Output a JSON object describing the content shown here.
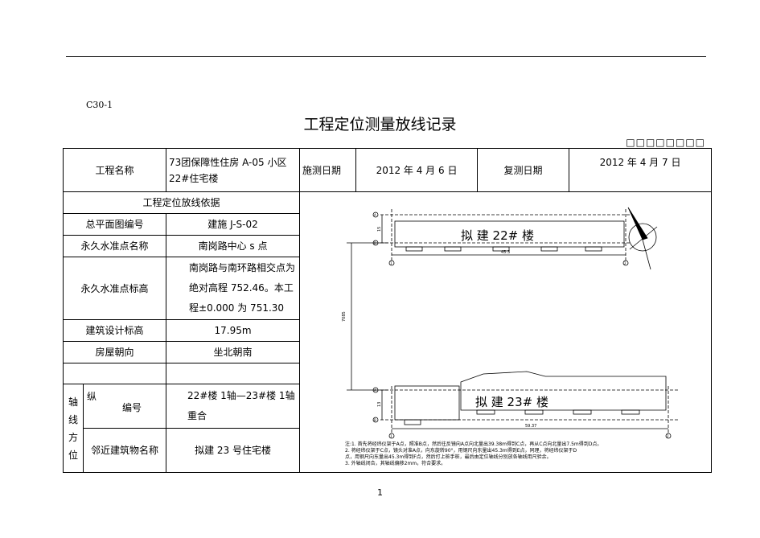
{
  "header": {
    "form_code": "C30-1",
    "title": "工程定位测量放线记录",
    "boxes": "□□□□□□□□"
  },
  "table": {
    "project_name_label": "工程名称",
    "project_name_value": "73团保障性住房 A-05 小区 22#住宅楼",
    "survey_date_label": "施测日期",
    "survey_date_value": "2012 年 4 月 6 日",
    "recheck_date_label": "复测日期",
    "recheck_date_value": "2012 年 4 月 7 日",
    "basis_header": "工程定位放线依据",
    "rows": [
      {
        "label": "总平面图编号",
        "value": "建施 J-S-02"
      },
      {
        "label": "永久水准点名称",
        "value": "南岗路中心 s 点"
      },
      {
        "label": "永久水准点标高",
        "value": "南岗路与南环路相交点为绝对高程 752.46。本工程±0.000 为 751.30"
      },
      {
        "label": "建筑设计标高",
        "value": "17.95m"
      },
      {
        "label": "房屋朝向",
        "value": "坐北朝南"
      },
      {
        "label": "",
        "value": ""
      }
    ],
    "axis_label": "轴线方位",
    "axis_sub1": "纵",
    "axis_no_label": "编号",
    "axis_no_value": "22#楼 1轴—23#楼 1轴重合",
    "adjacent_label": "邻近建筑物名称",
    "adjacent_value": "拟建 23 号住宅楼"
  },
  "drawing": {
    "building1": "拟 建 22# 楼",
    "building2": "拟 建 23# 楼",
    "dim_top": "45.3",
    "dim_bottom": "59.37",
    "dim_vertical": "7085",
    "dim_small1": "15",
    "dim_small2": "13",
    "axis_a": "A",
    "axis_b": "B",
    "axis_1": "1",
    "axis_2": "2",
    "notes": [
      "注:1. 首先将经纬仪架于A点，照准B点，然后往反镜向A点向北量出39.38m得到C点，再从C点向北量出7.5m得到D点。",
      "2. 将经纬仪架于C点，镜头对准A点，向东旋转90°，用钢尺向东量出45.3m得到E点，同理，将经纬仪架于D",
      "点，用钢尺向东量出45.3m得到F点，然后打上桩手桩，最后由定位轴线分别放各轴线用尺验余。",
      "3. 外轴线闭合，其轴线偏移2mm，符合要求。"
    ]
  },
  "footer": {
    "page_number": "1"
  }
}
